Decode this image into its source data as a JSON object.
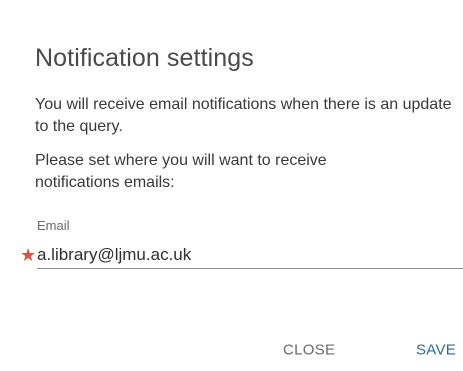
{
  "dialog": {
    "title": "Notification settings",
    "description": "You will receive email notifications when there is an update to the query.",
    "instruction": "Please set where you will want to receive notifications emails:",
    "email_field": {
      "label": "Email",
      "value": "a.library@ljmu.ac.uk",
      "required_marker": "★"
    },
    "buttons": {
      "close_label": "CLOSE",
      "save_label": "SAVE"
    }
  },
  "colors": {
    "accent": "#2c6aa0",
    "required": "#e0533d"
  }
}
